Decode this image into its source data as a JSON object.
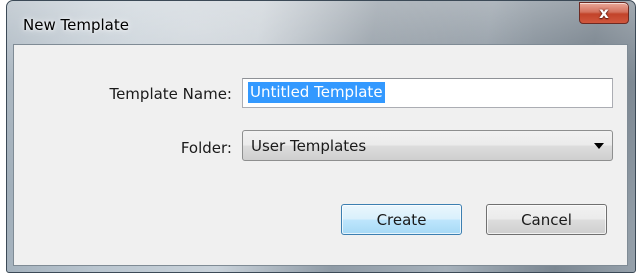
{
  "window": {
    "title": "New Template",
    "close_symbol": "x",
    "close_icon": "close-icon"
  },
  "form": {
    "template_name_label": "Template Name:",
    "template_name_value": "Untitled Template",
    "folder_label": "Folder:",
    "folder_selected": "User Templates",
    "dropdown_icon": "chevron-down-icon"
  },
  "buttons": {
    "create_label": "Create",
    "cancel_label": "Cancel"
  },
  "colors": {
    "selection_highlight": "#3399ff",
    "close_button_red": "#c2432a",
    "default_button_blue": "#bee6fd",
    "dialog_background": "#f0f0f0"
  }
}
